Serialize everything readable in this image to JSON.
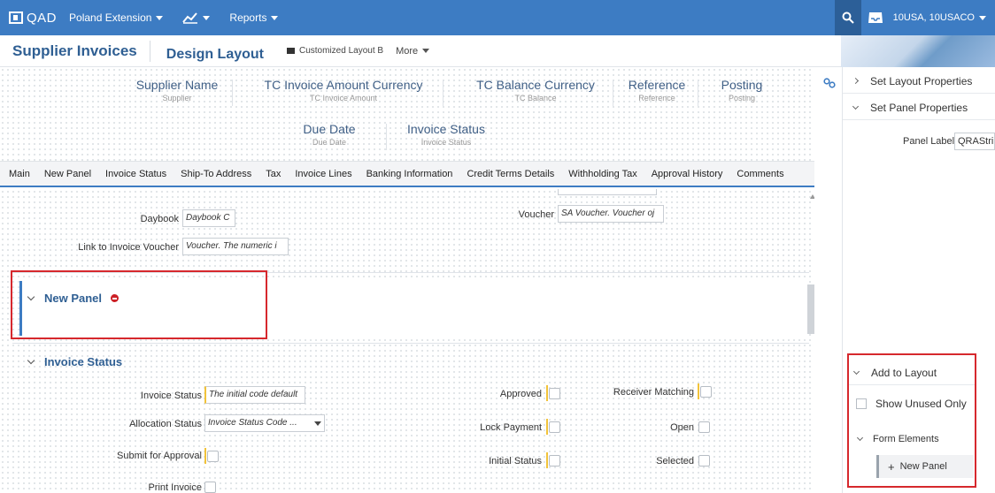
{
  "topbar": {
    "logo": "QAD",
    "nav": [
      {
        "label": "Poland Extension",
        "has_caret": true
      },
      {
        "label": "",
        "icon": "chart-line-icon",
        "has_caret": true
      },
      {
        "label": "Reports",
        "has_caret": true
      }
    ],
    "entity": "10USA, 10USACO"
  },
  "header": {
    "title": "Supplier Invoices",
    "design": "Design Layout",
    "layout_name": "Customized Layout B",
    "more": "More"
  },
  "summary_fields": [
    {
      "label": "Supplier  Name",
      "sub": "Supplier"
    },
    {
      "label": "TC Invoice Amount  Currency",
      "sub": "TC Invoice Amount"
    },
    {
      "label": "TC Balance  Currency",
      "sub": "TC Balance"
    },
    {
      "label": "Reference",
      "sub": "Reference"
    },
    {
      "label": "Posting",
      "sub": "Posting"
    },
    {
      "label": "Due Date",
      "sub": "Due Date"
    },
    {
      "label": "Invoice Status",
      "sub": "Invoice Status"
    }
  ],
  "tabs": [
    "Main",
    "New Panel",
    "Invoice Status",
    "Ship-To Address",
    "Tax",
    "Invoice Lines",
    "Banking Information",
    "Credit Terms Details",
    "Withholding Tax",
    "Approval History",
    "Comments"
  ],
  "main_fields": {
    "daybook_label": "Daybook",
    "daybook_value": "Daybook C",
    "link_label": "Link to Invoice Voucher",
    "link_value": "Voucher. The numeric i",
    "voucher_label": "Voucher",
    "voucher_value": "SA Voucher. Voucher oj"
  },
  "new_panel": {
    "title": "New Panel"
  },
  "invoice_status_panel": {
    "title": "Invoice Status",
    "invoice_status_label": "Invoice Status",
    "invoice_status_value": "The initial code default",
    "allocation_label": "Allocation Status",
    "allocation_value": "Invoice Status Code ...",
    "submit_label": "Submit for Approval",
    "print_label": "Print Invoice",
    "approved_label": "Approved",
    "lock_label": "Lock Payment",
    "initial_label": "Initial Status",
    "receiver_label": "Receiver Matching",
    "open_label": "Open",
    "selected_label": "Selected"
  },
  "right_panel": {
    "set_layout": "Set Layout Properties",
    "set_panel": "Set Panel Properties",
    "panel_label": "Panel Label",
    "panel_label_value": "QRAString",
    "add_to_layout": "Add to Layout",
    "show_unused": "Show Unused Only",
    "form_elements": "Form Elements",
    "new_panel_btn": "New Panel"
  },
  "colors": {
    "accent": "#3d7cc3",
    "highlight": "#d6282d",
    "required": "#f2c33a"
  }
}
